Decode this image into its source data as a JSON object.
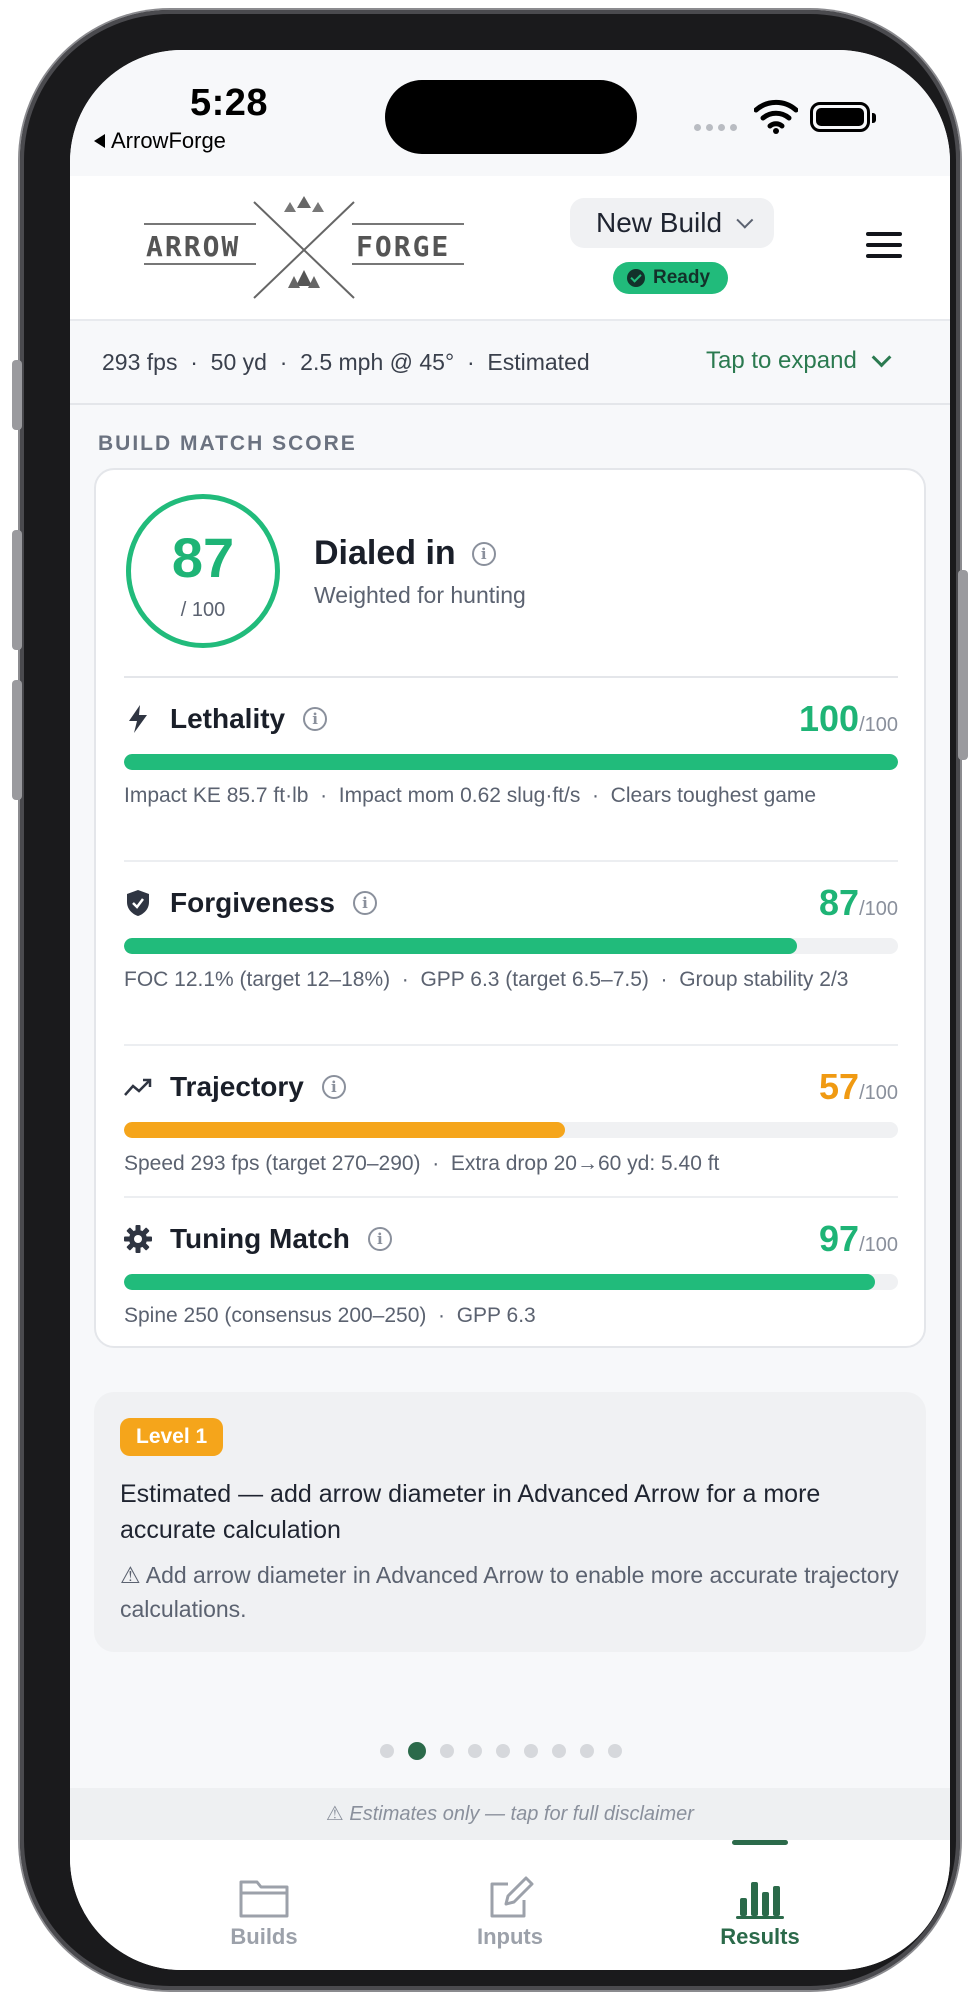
{
  "status": {
    "time": "5:28",
    "back_app": "ArrowForge"
  },
  "header": {
    "logo_left": "ARROW",
    "logo_right": "FORGE",
    "build_name": "New Build",
    "status_badge": "Ready"
  },
  "summary": {
    "text": "293 fps  ·  50 yd  ·  2.5 mph @ 45°  ·  Estimated",
    "expand_label": "Tap to expand"
  },
  "section_title": "BUILD MATCH SCORE",
  "score": {
    "value": "87",
    "of": "/ 100",
    "headline": "Dialed in",
    "subline": "Weighted for hunting"
  },
  "metrics": [
    {
      "name": "Lethality",
      "score": "100",
      "of": "/100",
      "level": 1.0,
      "color": "#21bb7b",
      "icon": "bolt-icon",
      "detail": "Impact KE 85.7 ft·lb  ·  Impact mom 0.62 slug·ft/s  ·  Clears toughest game"
    },
    {
      "name": "Forgiveness",
      "score": "87",
      "of": "/100",
      "level": 0.87,
      "color": "#21bb7b",
      "icon": "shield-icon",
      "detail": "FOC 12.1% (target 12–18%)  ·  GPP 6.3 (target 6.5–7.5)  ·  Group stability 2/3"
    },
    {
      "name": "Trajectory",
      "score": "57",
      "of": "/100",
      "level": 0.57,
      "color": "#f5a51b",
      "icon": "trend-up-icon",
      "detail": "Speed 293 fps (target 270–290)  ·  Extra drop 20→60 yd: 5.40 ft"
    },
    {
      "name": "Tuning Match",
      "score": "97",
      "of": "/100",
      "level": 0.97,
      "color": "#21bb7b",
      "icon": "gear-icon",
      "detail": "Spine 250 (consensus 200–250)  ·  GPP 6.3"
    }
  ],
  "note": {
    "level": "Level 1",
    "main": "Estimated — add arrow diameter in Advanced Arrow for a more accurate calculation",
    "warning": "⚠ Add arrow diameter in Advanced Arrow to enable more accurate trajectory calculations."
  },
  "pager": {
    "count": 9,
    "active": 1
  },
  "disclaimer": "⚠ Estimates only — tap for full disclaimer",
  "tabs": [
    {
      "label": "Builds",
      "icon": "folder-icon"
    },
    {
      "label": "Inputs",
      "icon": "edit-icon"
    },
    {
      "label": "Results",
      "icon": "bar-chart-icon",
      "active": true
    }
  ]
}
